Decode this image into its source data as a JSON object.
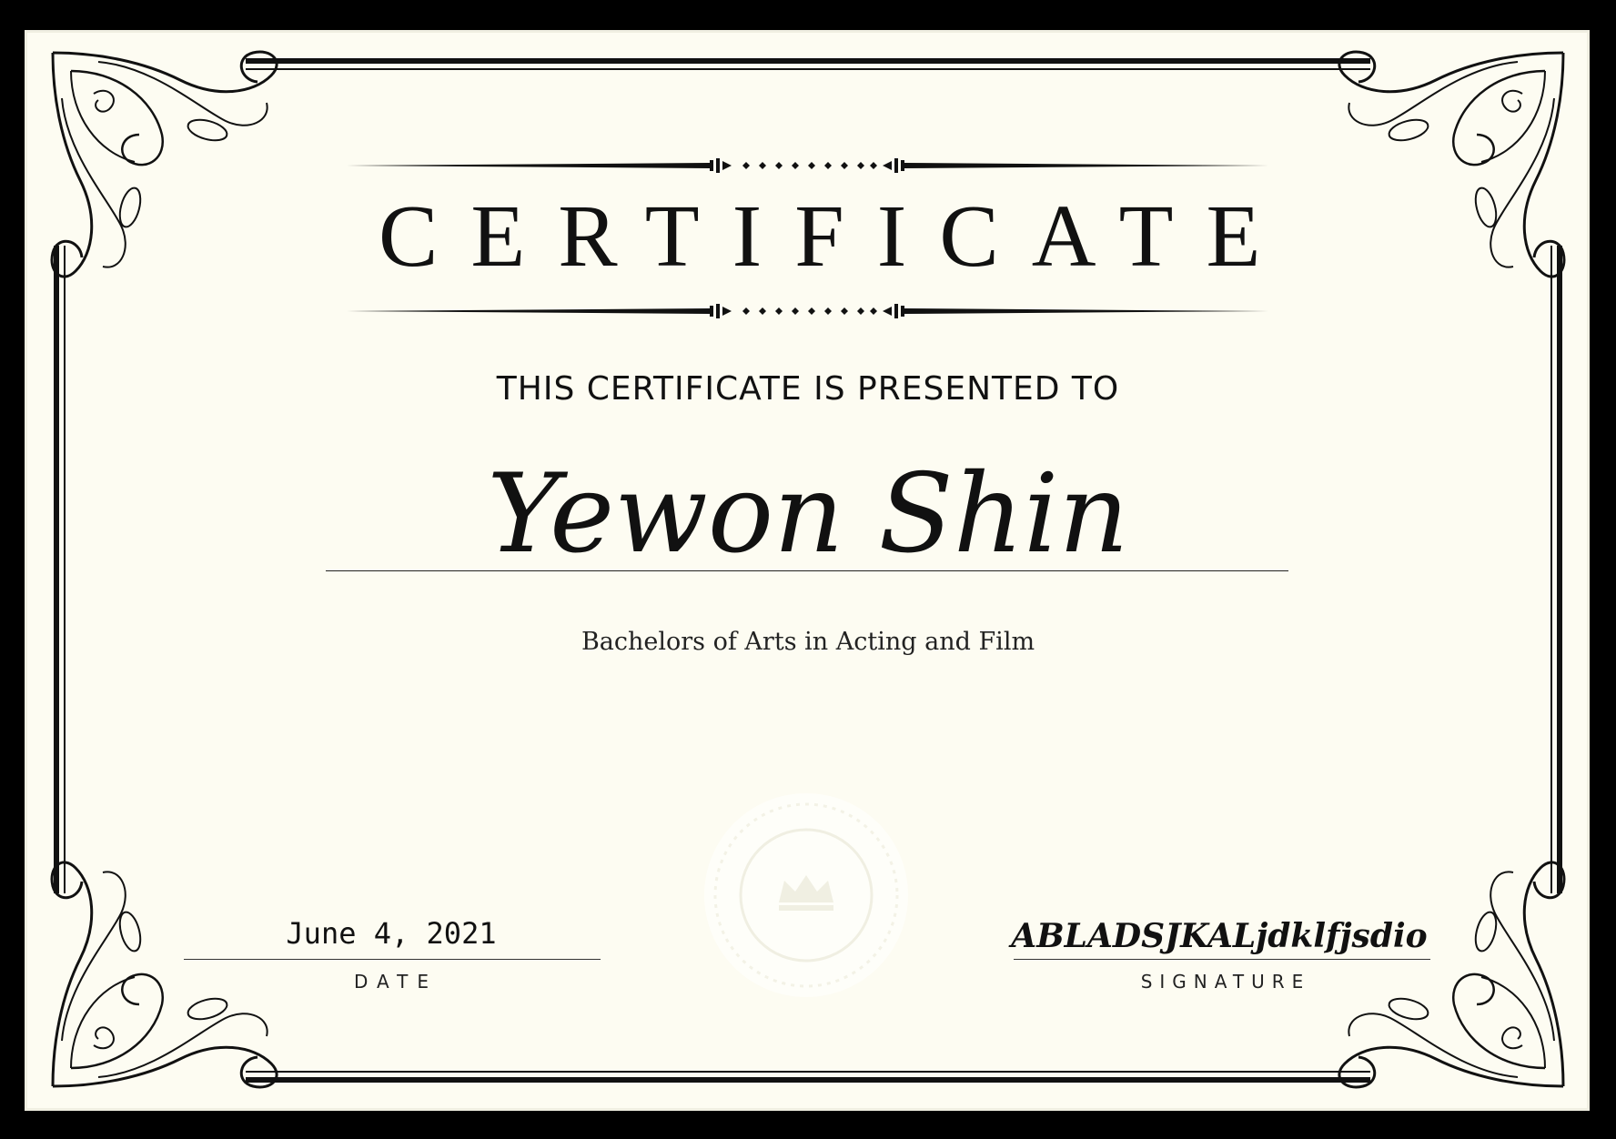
{
  "certificate": {
    "title": "CERTIFICATE",
    "presented_text": "THIS CERTIFICATE IS PRESENTED TO",
    "recipient_name": "Yewon Shin",
    "degree": "Bachelors of Arts in Acting and Film",
    "date": {
      "value": "June 4, 2021",
      "label": "DATE"
    },
    "signature": {
      "value": "ABLADSJKALjdklfjsdio",
      "label": "SIGNATURE"
    }
  },
  "colors": {
    "background": "#000000",
    "paper": "#fdfcf2",
    "ink": "#111111"
  },
  "icons": [
    "corner-flourish-icon",
    "crown-seal-icon",
    "title-divider-ornament-icon"
  ]
}
